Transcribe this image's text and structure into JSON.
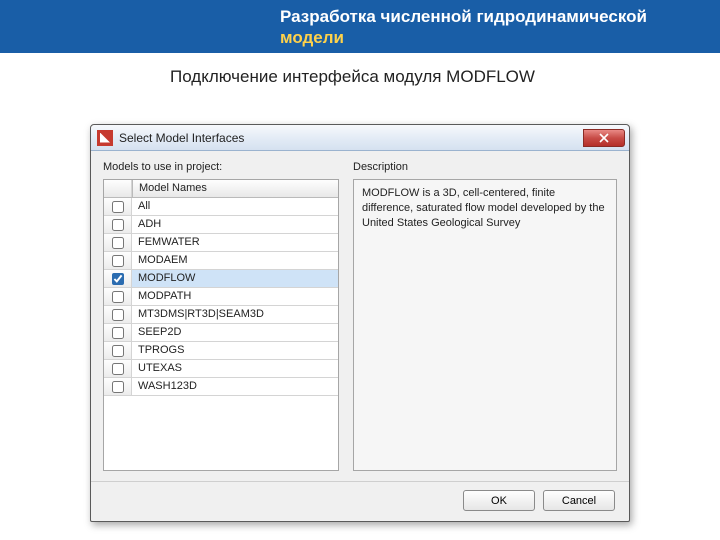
{
  "banner": {
    "line1": "Разработка численной гидродинамической",
    "line2": "модели"
  },
  "subtitle": "Подключение интерфейса модуля MODFLOW",
  "window": {
    "title": "Select Model Interfaces",
    "list_label": "Models to use in project:",
    "header": "Model Names",
    "desc_label": "Description",
    "description": "MODFLOW is a 3D, cell-centered, finite difference, saturated flow model developed by the United States Geological Survey",
    "models": [
      {
        "name": "All",
        "checked": false
      },
      {
        "name": "ADH",
        "checked": false
      },
      {
        "name": "FEMWATER",
        "checked": false
      },
      {
        "name": "MODAEM",
        "checked": false
      },
      {
        "name": "MODFLOW",
        "checked": true,
        "selected": true
      },
      {
        "name": "MODPATH",
        "checked": false
      },
      {
        "name": "MT3DMS|RT3D|SEAM3D",
        "checked": false
      },
      {
        "name": "SEEP2D",
        "checked": false
      },
      {
        "name": "TPROGS",
        "checked": false
      },
      {
        "name": "UTEXAS",
        "checked": false
      },
      {
        "name": "WASH123D",
        "checked": false
      }
    ],
    "ok": "OK",
    "cancel": "Cancel"
  }
}
